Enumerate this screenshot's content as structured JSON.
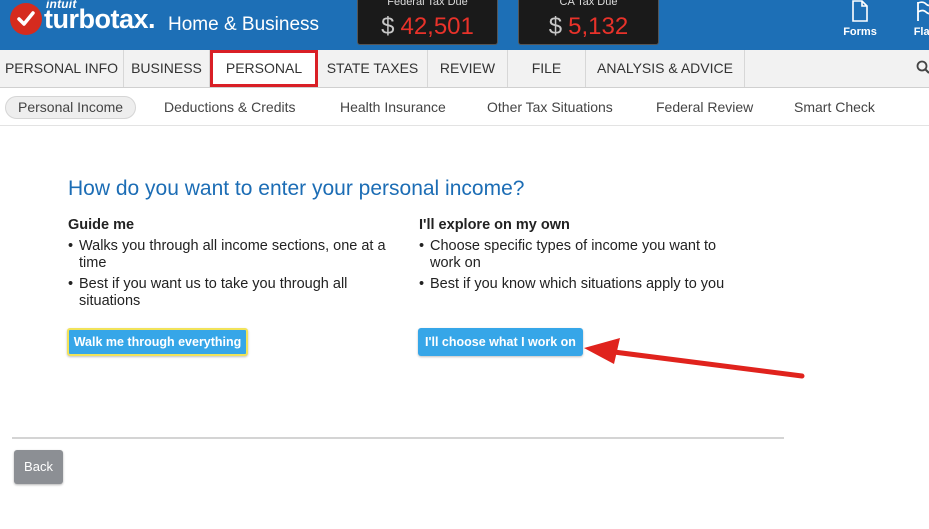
{
  "header": {
    "intuit": "intuit",
    "brand": "turbotax",
    "brand_dot": ".",
    "edition": "Home & Business",
    "federal": {
      "label": "Federal Tax Due",
      "currency": "$",
      "amount": "42,501"
    },
    "state": {
      "label": "CA Tax Due",
      "currency": "$",
      "amount": "5,132"
    },
    "forms_label": "Forms",
    "flag_label": "Flag",
    "colors": {
      "bar": "#1d6fb6",
      "amount": "#e8322a",
      "logo": "#d52b1e"
    }
  },
  "main_nav": {
    "tabs": [
      {
        "label": "PERSONAL INFO"
      },
      {
        "label": "BUSINESS"
      },
      {
        "label": "PERSONAL"
      },
      {
        "label": "STATE TAXES"
      },
      {
        "label": "REVIEW"
      },
      {
        "label": "FILE"
      },
      {
        "label": "ANALYSIS & ADVICE"
      }
    ],
    "active": "PERSONAL"
  },
  "sub_nav": {
    "items": [
      {
        "label": "Personal Income"
      },
      {
        "label": "Deductions & Credits"
      },
      {
        "label": "Health Insurance"
      },
      {
        "label": "Other Tax Situations"
      },
      {
        "label": "Federal Review"
      },
      {
        "label": "Smart Check"
      }
    ],
    "active": "Personal Income"
  },
  "content": {
    "question": "How do you want to enter your personal income?",
    "left": {
      "heading": "Guide me",
      "bullets": [
        "Walks you through all income sections, one at a time",
        "Best if you want us to take you through all situations"
      ],
      "button": "Walk me through everything"
    },
    "right": {
      "heading": "I'll explore on my own",
      "bullets": [
        "Choose specific types of income you want to work on",
        "Best if you know which situations apply to you"
      ],
      "button": "I'll choose what I work on"
    }
  },
  "footer": {
    "back_label": "Back"
  }
}
